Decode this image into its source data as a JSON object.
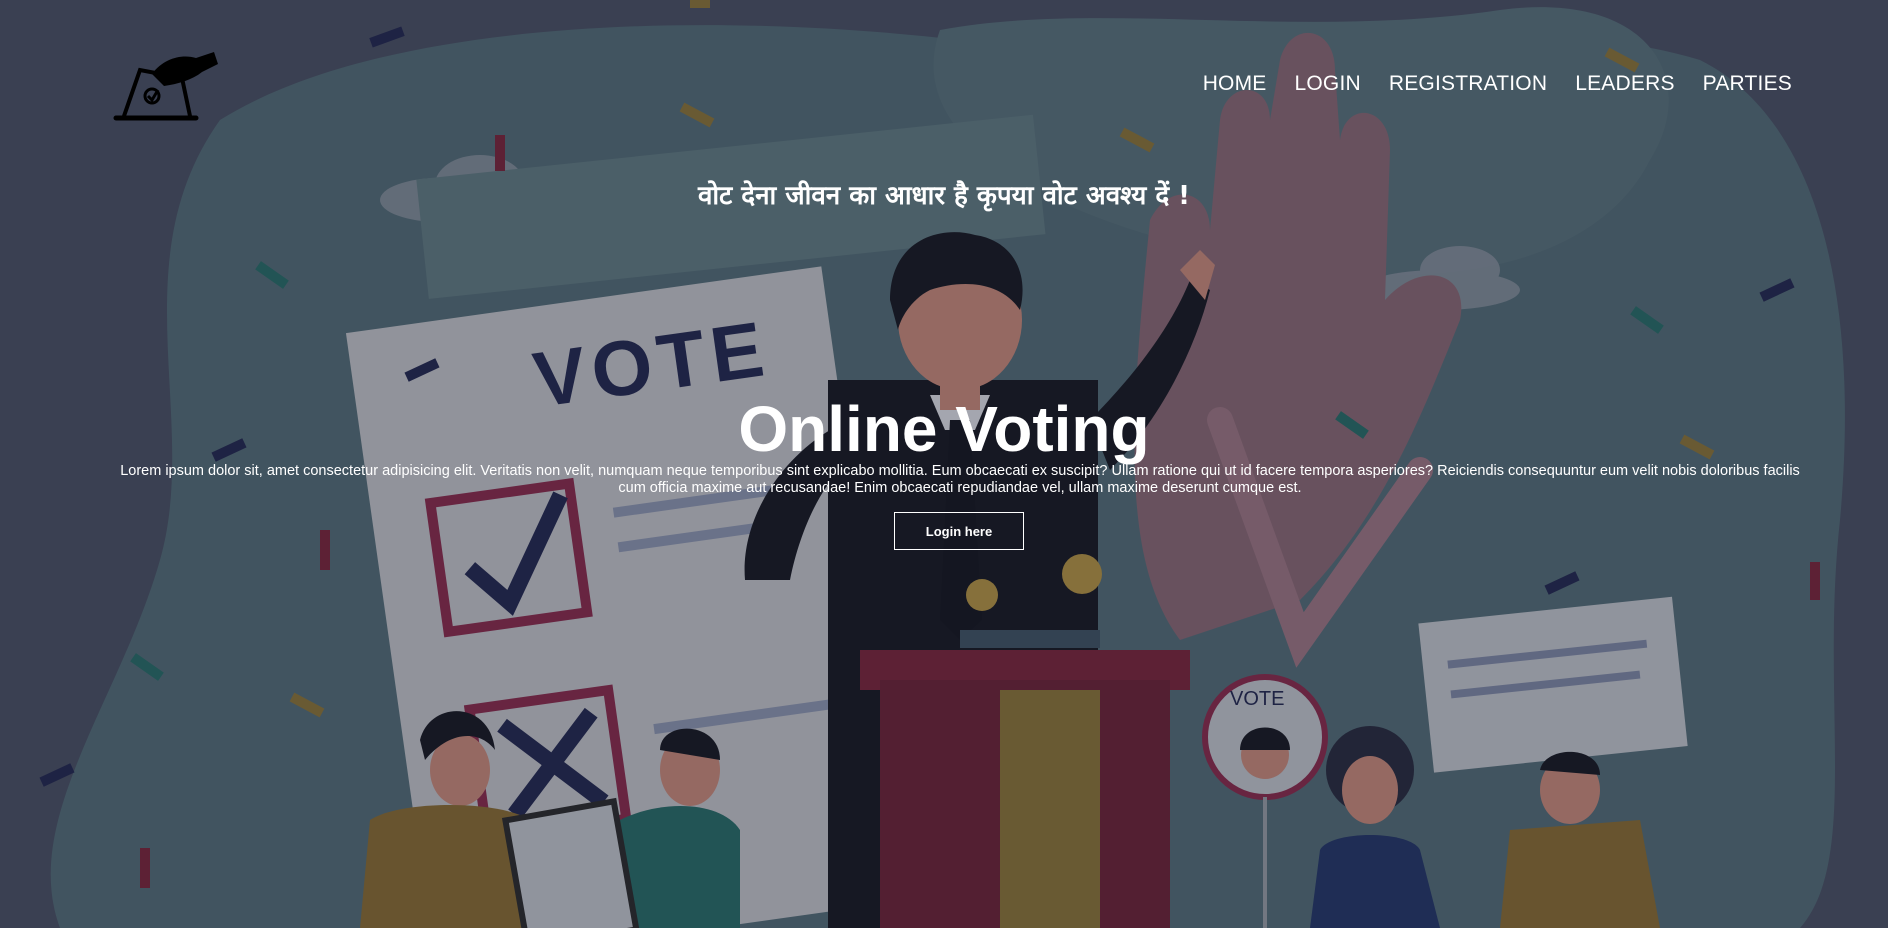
{
  "header": {
    "logo_icon": "ballot-box-hand-icon",
    "nav": [
      {
        "label": "HOME"
      },
      {
        "label": "LOGIN"
      },
      {
        "label": "REGISTRATION"
      },
      {
        "label": "LEADERS"
      },
      {
        "label": "PARTIES"
      }
    ]
  },
  "hero": {
    "tagline": "वोट देना जीवन का आधार है कृपया वोट अवश्य दें !",
    "title": "Online Voting",
    "description": "Lorem ipsum dolor sit, amet consectetur adipisicing elit. Veritatis non velit, numquam neque temporibus sint explicabo mollitia. Eum obcaecati ex suscipit? Ullam ratione qui ut id facere tempora asperiores? Reiciendis consequuntur eum velit nobis doloribus facilis cum officia maxime aut recusandae! Enim obcaecati repudiandae vel, ullam maxime deserunt cumque est.",
    "button_label": "Login here",
    "illustration": {
      "ballot_text": "VOTE",
      "badge_text": "VOTE"
    }
  }
}
